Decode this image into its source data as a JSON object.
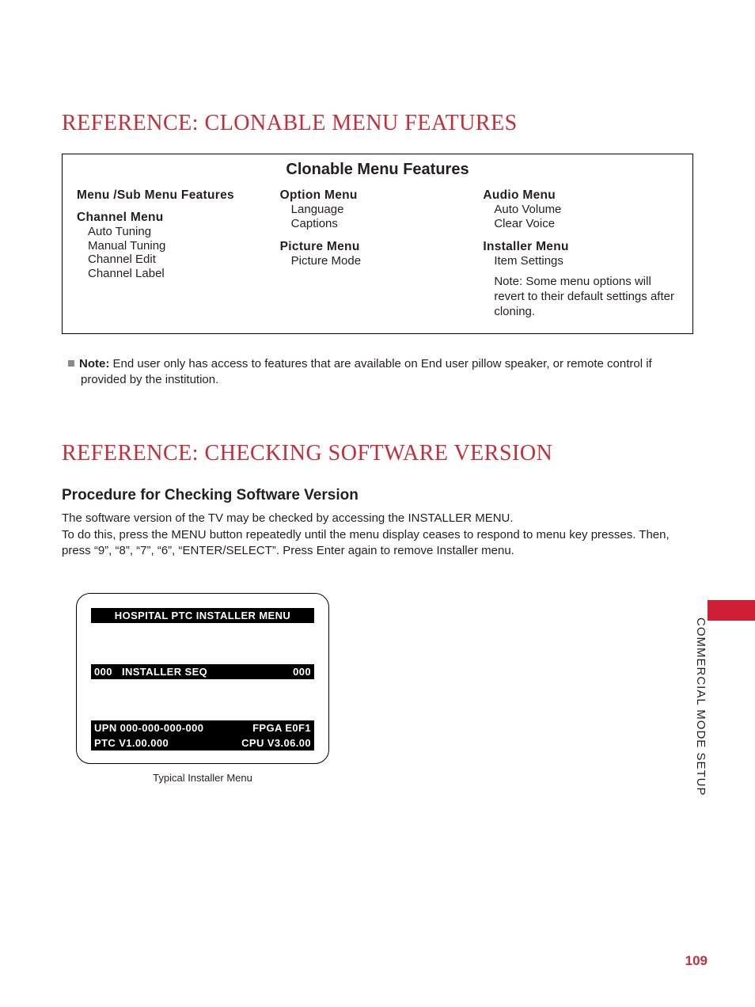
{
  "section1": {
    "title": "REFERENCE: CLONABLE MENU FEATURES",
    "box_title": "Clonable Menu Features",
    "col1": {
      "head1": "Menu /Sub Menu Features",
      "head2": "Channel Menu",
      "items": [
        "Auto Tuning",
        "Manual Tuning",
        "Channel Edit",
        "Channel Label"
      ]
    },
    "col2": {
      "head1": "Option Menu",
      "items1": [
        "Language",
        "Captions"
      ],
      "head2": "Picture Menu",
      "items2": [
        "Picture Mode"
      ]
    },
    "col3": {
      "head1": "Audio Menu",
      "items1": [
        "Auto Volume",
        "Clear Voice"
      ],
      "head2": "Installer Menu",
      "items2": [
        "Item Settings"
      ],
      "note": "Note: Some menu options will revert to their default settings after cloning."
    },
    "footnote_label": "Note:",
    "footnote_text": " End user only has access to features that are available on End user pillow speaker, or remote control if provided by the institution."
  },
  "section2": {
    "title": "REFERENCE: CHECKING SOFTWARE VERSION",
    "subhead": "Procedure for Checking Software Version",
    "p1": "The software version of the TV may be checked by accessing the INSTALLER MENU.",
    "p2": "To do this, press the MENU button repeatedly until the menu display ceases to respond to menu key presses. Then, press “9”, “8”, “7”, “6”, “ENTER/SELECT”.  Press Enter again to remove Installer menu."
  },
  "screen": {
    "title": "HOSPITAL PTC  INSTALLER  MENU",
    "row2_left": "000",
    "row2_mid": "INSTALLER SEQ",
    "row2_right": "000",
    "row3_left": "UPN   000-000-000-000",
    "row3_right": "FPGA E0F1",
    "row4_left": "PTC V1.00.000",
    "row4_right": "CPU V3.06.00",
    "caption": "Typical Installer Menu"
  },
  "side_label": "COMMERCIAL MODE SETUP",
  "page_number": "109"
}
